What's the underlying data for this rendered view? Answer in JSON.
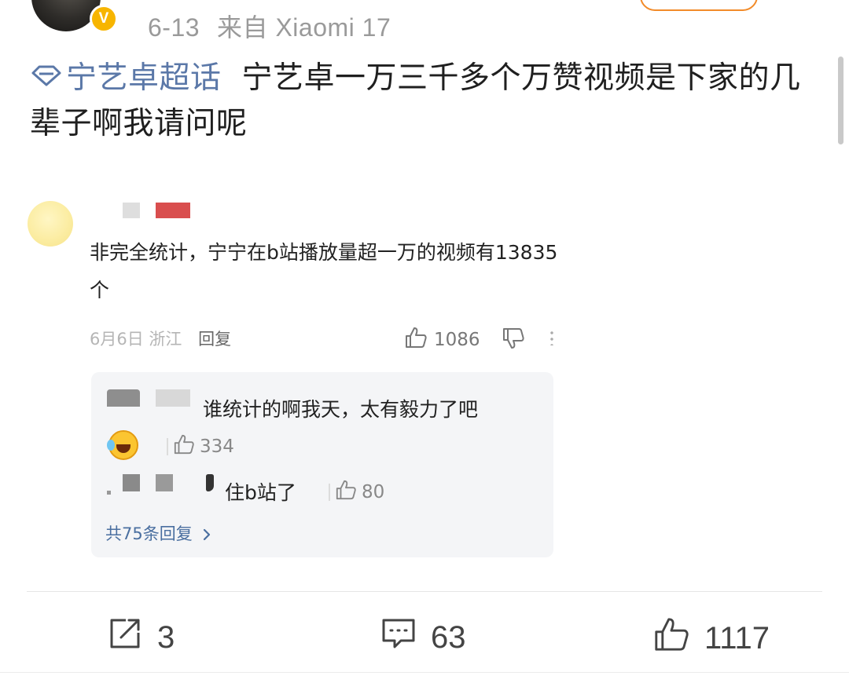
{
  "post": {
    "verified_badge": "V",
    "date": "6-13",
    "source": "来自 Xiaomi 17",
    "topic": "宁艺卓超话",
    "text": "宁艺卓一万三千多个万赞视频是下家的几辈子啊我请问呢"
  },
  "comment": {
    "text": "非完全统计，宁宁在b站播放量超一万的视频有13835个",
    "date": "6月6日",
    "location": "浙江",
    "reply_label": "回复",
    "likes": "1086",
    "replies": [
      {
        "text": "谁统计的啊我天，太有毅力了吧",
        "likes": "334"
      },
      {
        "text": "住b站了",
        "likes": "80"
      }
    ],
    "more_replies": "共75条回复"
  },
  "actions": {
    "share_count": "3",
    "comment_count": "63",
    "like_count": "1117"
  },
  "icons": {
    "share": "share-icon",
    "comment": "comment-icon",
    "like": "thumbs-up-icon",
    "dislike": "thumbs-down-icon",
    "topic": "diamond-icon",
    "chevron": "chevron-right-icon"
  },
  "colors": {
    "topic_link": "#5b78a8",
    "verified": "#f7b500",
    "reply_link": "#4a6fa0"
  }
}
